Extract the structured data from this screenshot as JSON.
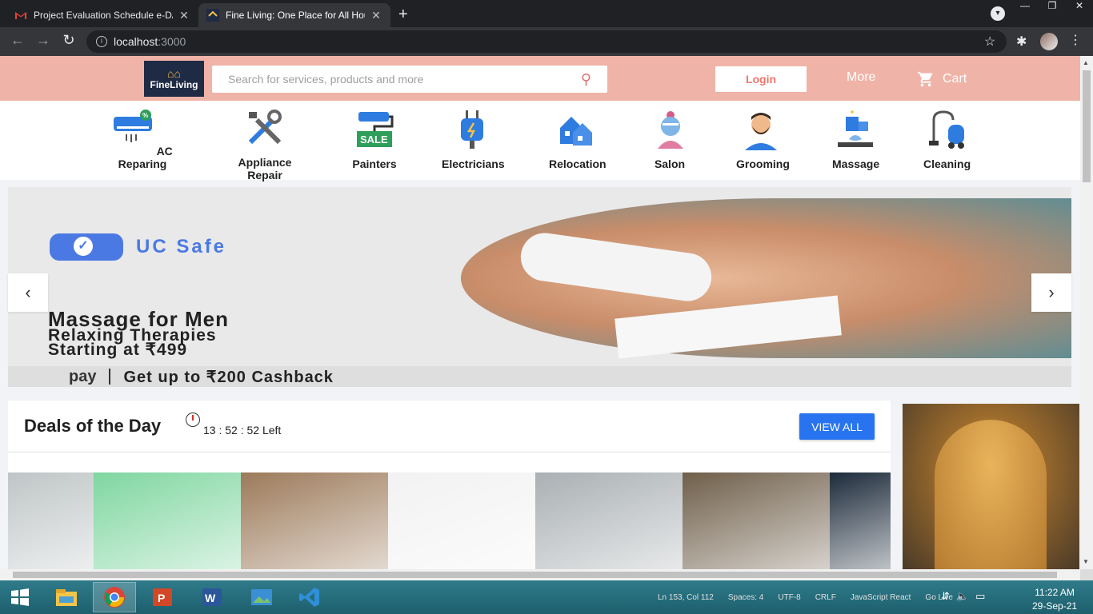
{
  "browser": {
    "tabs": [
      {
        "title": "Project Evaluation Schedule e-DA",
        "close": "✕",
        "active": false
      },
      {
        "title": "Fine Living: One Place for All Hou",
        "close": "✕",
        "active": true
      }
    ],
    "new_tab": "+",
    "url_host": "localhost",
    "url_port": ":3000",
    "window_controls": [
      "—",
      "❐",
      "✕"
    ]
  },
  "header": {
    "logo_text": "FineLiving",
    "search_placeholder": "Search for services, products and more",
    "login_label": "Login",
    "more_label": "More",
    "cart_label": "Cart"
  },
  "categories": [
    {
      "label": "AC Reparing",
      "icon": "ac-icon"
    },
    {
      "label": "Appliance Repair",
      "icon": "tools-icon"
    },
    {
      "label": "Painters",
      "icon": "paint-roller-icon"
    },
    {
      "label": "Electricians",
      "icon": "plug-icon"
    },
    {
      "label": "Relocation",
      "icon": "house-move-icon"
    },
    {
      "label": "Salon",
      "icon": "face-mask-icon"
    },
    {
      "label": "Grooming",
      "icon": "beard-man-icon"
    },
    {
      "label": "Massage",
      "icon": "spa-candle-icon"
    },
    {
      "label": "Cleaning",
      "icon": "vacuum-icon"
    }
  ],
  "banner": {
    "badge": "UC Safe",
    "headline": "Massage for Men",
    "sub1": "Relaxing Therapies",
    "sub2": "Starting at ₹499",
    "pay": "pay",
    "cashback": "Get up to ₹200 Cashback",
    "prev": "‹",
    "next": "›"
  },
  "deals": {
    "title": "Deals of the Day",
    "timer": "13 : 52 : 52 Left",
    "view_all": "VIEW ALL",
    "products": [
      {
        "name": "water-purifier",
        "color": "#bfc5c6"
      },
      {
        "name": "humidifier",
        "color": "#7fd6a0"
      },
      {
        "name": "robot-vacuum",
        "color": "#9c7a5a"
      },
      {
        "name": "cleaning-bottles",
        "color": "#f2f2f2"
      },
      {
        "name": "air-filter",
        "color": "#aab0b3"
      },
      {
        "name": "essential-oils",
        "color": "#6f5f4a"
      },
      {
        "name": "dark-product",
        "color": "#1c2a3a"
      }
    ]
  },
  "taskbar": {
    "status_items": [
      "Ln 153, Col 112",
      "Spaces: 4",
      "UTF-8",
      "CRLF",
      "JavaScript React",
      "Go Live"
    ],
    "time": "11:22 AM",
    "date": "29-Sep-21"
  }
}
